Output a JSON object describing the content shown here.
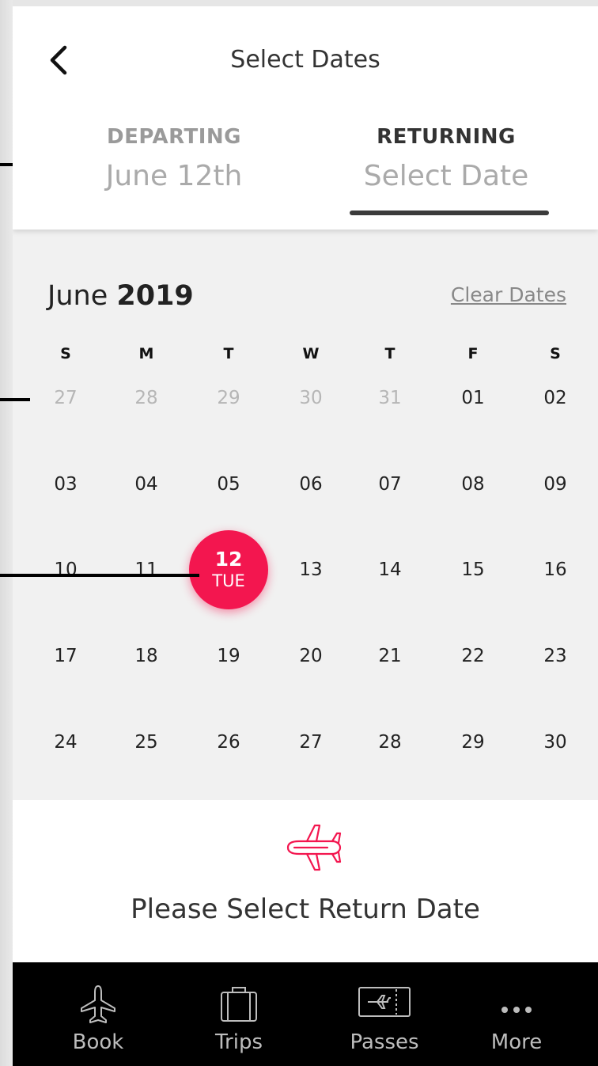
{
  "header": {
    "title": "Select Dates",
    "departing": {
      "label": "DEPARTING",
      "value": "June 12th"
    },
    "returning": {
      "label": "RETURNING",
      "value": "Select Date"
    }
  },
  "calendar": {
    "month": "June",
    "year": "2019",
    "clear_label": "Clear Dates",
    "weekdays": [
      "S",
      "M",
      "T",
      "W",
      "T",
      "F",
      "S"
    ],
    "weeks": [
      [
        {
          "d": "27",
          "muted": true
        },
        {
          "d": "28",
          "muted": true
        },
        {
          "d": "29",
          "muted": true
        },
        {
          "d": "30",
          "muted": true
        },
        {
          "d": "31",
          "muted": true
        },
        {
          "d": "01"
        },
        {
          "d": "02"
        }
      ],
      [
        {
          "d": "03"
        },
        {
          "d": "04"
        },
        {
          "d": "05"
        },
        {
          "d": "06"
        },
        {
          "d": "07"
        },
        {
          "d": "08"
        },
        {
          "d": "09"
        }
      ],
      [
        {
          "d": "10"
        },
        {
          "d": "11"
        },
        {
          "d": "12",
          "selected": true,
          "dow": "TUE"
        },
        {
          "d": "13"
        },
        {
          "d": "14"
        },
        {
          "d": "15"
        },
        {
          "d": "16"
        }
      ],
      [
        {
          "d": "17"
        },
        {
          "d": "18"
        },
        {
          "d": "19"
        },
        {
          "d": "20"
        },
        {
          "d": "21"
        },
        {
          "d": "22"
        },
        {
          "d": "23"
        }
      ],
      [
        {
          "d": "24"
        },
        {
          "d": "25"
        },
        {
          "d": "26"
        },
        {
          "d": "27"
        },
        {
          "d": "28"
        },
        {
          "d": "29"
        },
        {
          "d": "30"
        }
      ]
    ]
  },
  "prompt": {
    "icon": "airplane-icon",
    "text": "Please Select Return Date"
  },
  "tabbar": {
    "items": [
      {
        "label": "Book",
        "icon": "airplane-icon"
      },
      {
        "label": "Trips",
        "icon": "suitcase-icon"
      },
      {
        "label": "Passes",
        "icon": "boarding-pass-icon"
      },
      {
        "label": "More",
        "icon": "more-icon"
      }
    ]
  },
  "colors": {
    "accent": "#f3164f",
    "tabbar_bg": "#000000",
    "calendar_bg": "#f1f1f1"
  }
}
